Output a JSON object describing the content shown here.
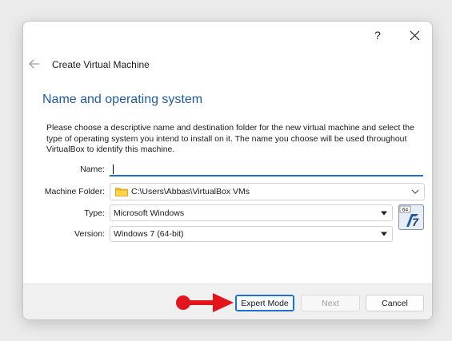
{
  "titlebar": {
    "help_label": "?",
    "close_icon": "close-icon"
  },
  "wizard": {
    "title": "Create Virtual Machine",
    "back_icon": "back-arrow-icon"
  },
  "page": {
    "heading": "Name and operating system",
    "description": "Please choose a descriptive name and destination folder for the new virtual machine and select the type of operating system you intend to install on it. The name you choose will be used throughout VirtualBox to identify this machine."
  },
  "form": {
    "name_label": "Name:",
    "name_value": "",
    "folder_label": "Machine Folder:",
    "folder_value": "C:\\Users\\Abbas\\VirtualBox VMs",
    "type_label": "Type:",
    "type_value": "Microsoft Windows",
    "version_label": "Version:",
    "version_value": "Windows 7 (64-bit)",
    "os_icon": "windows-7-64bit-icon",
    "os_icon_badge": "64",
    "os_icon_digit": "7"
  },
  "footer": {
    "expert_label": "Expert Mode",
    "next_label": "Next",
    "cancel_label": "Cancel"
  },
  "colors": {
    "heading": "#1f5aa6",
    "accent": "#1f6fd1",
    "annotation_arrow": "#e3141b"
  }
}
